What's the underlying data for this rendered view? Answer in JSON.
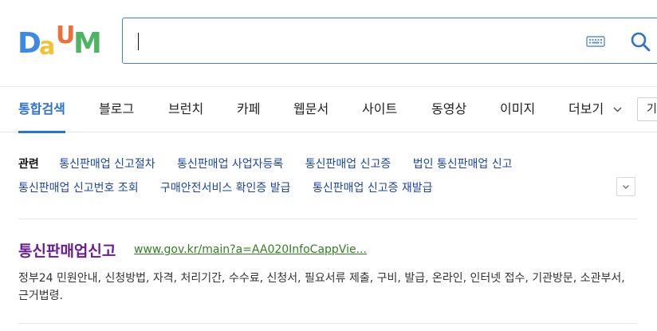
{
  "brand": {
    "logo_letters": [
      "D",
      "a",
      "U",
      "M"
    ],
    "colors": {
      "d": "#3d8ae5",
      "a": "#f1c232",
      "u": "#ef6f3b",
      "m": "#4db463"
    }
  },
  "search": {
    "value": "",
    "placeholder": ""
  },
  "icons": {
    "keyboard": "keyboard-icon",
    "search": "search-icon",
    "chevron": "chevron-down-icon"
  },
  "nav": {
    "tabs": [
      {
        "label": "통합검색",
        "active": true
      },
      {
        "label": "블로그"
      },
      {
        "label": "브런치"
      },
      {
        "label": "카페"
      },
      {
        "label": "웹문서"
      },
      {
        "label": "사이트"
      },
      {
        "label": "동영상"
      },
      {
        "label": "이미지"
      },
      {
        "label": "더보기"
      }
    ],
    "tool_label": "기"
  },
  "related": {
    "label": "관련",
    "items": [
      "통신판매업 신고절차",
      "통신판매업 사업자등록",
      "통신판매업 신고증",
      "법인 통신판매업 신고",
      "통신판매업 신고번호 조회",
      "구매안전서비스 확인증 발급",
      "통신판매업 신고증 재발급"
    ]
  },
  "result": {
    "title": "통신판매업신고",
    "url": "www.gov.kr/main?a=AA020InfoCappVie...",
    "description": "정부24 민원안내, 신청방법, 자격, 처리기간, 수수료, 신청서, 필요서류 제출, 구비, 발급, 온라인, 인터넷 접수, 기관방문, 소관부서, 근거법령."
  },
  "theme": {
    "accent": "#2c73d2",
    "link": "#1a45a7",
    "visited": "#6b1c91",
    "url": "#30821f"
  }
}
